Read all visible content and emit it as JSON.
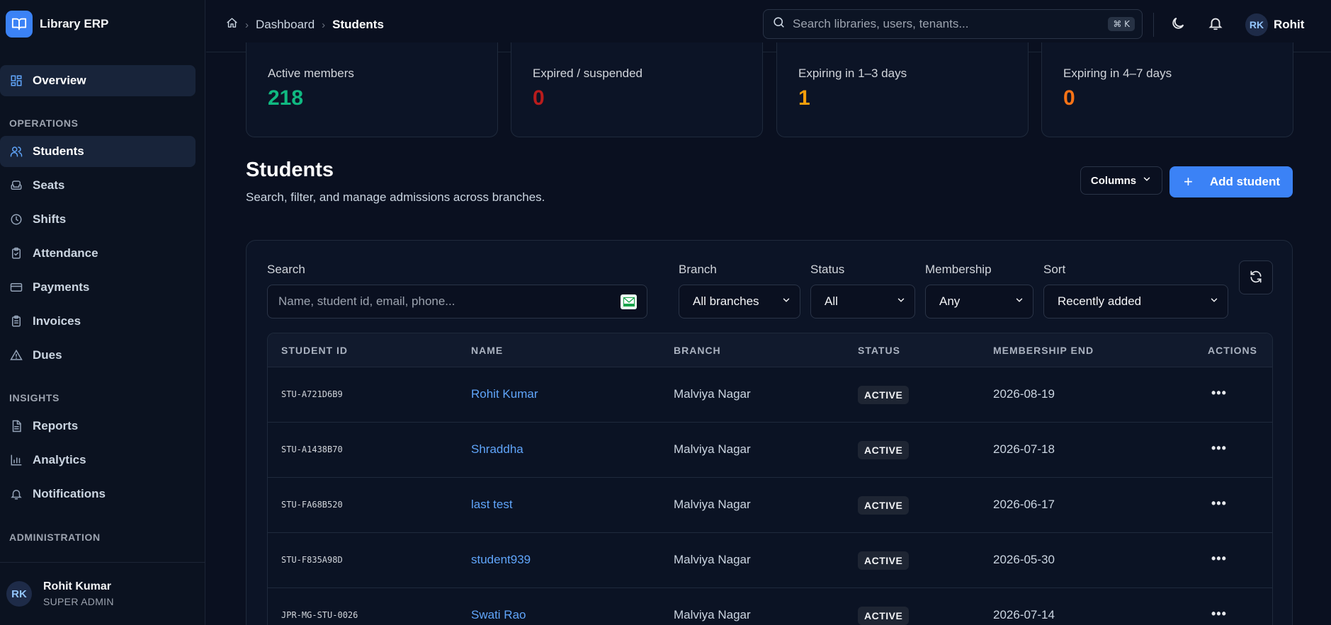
{
  "app": {
    "name": "Library ERP"
  },
  "sidebar": {
    "overview": "Overview",
    "sections": {
      "operations": "OPERATIONS",
      "insights": "INSIGHTS",
      "administration": "ADMINISTRATION"
    },
    "operations": [
      "Students",
      "Seats",
      "Shifts",
      "Attendance",
      "Payments",
      "Invoices",
      "Dues"
    ],
    "insights": [
      "Reports",
      "Analytics",
      "Notifications"
    ],
    "user": {
      "initials": "RK",
      "name": "Rohit Kumar",
      "role": "SUPER ADMIN"
    }
  },
  "topbar": {
    "breadcrumb": [
      "Dashboard",
      "Students"
    ],
    "search_placeholder": "Search libraries, users, tenants...",
    "shortcut": "⌘ K",
    "user": {
      "initials": "RK",
      "name": "Rohit"
    }
  },
  "stats": [
    {
      "label": "Active members",
      "value": "218",
      "color": "#10b981"
    },
    {
      "label": "Expired / suspended",
      "value": "0",
      "color": "#b91c1c"
    },
    {
      "label": "Expiring in 1–3 days",
      "value": "1",
      "color": "#f59e0b"
    },
    {
      "label": "Expiring in 4–7 days",
      "value": "0",
      "color": "#f97316"
    }
  ],
  "page": {
    "title": "Students",
    "subtitle": "Search, filter, and manage admissions across branches.",
    "columns_button": "Columns",
    "add_button": "Add student"
  },
  "filters": {
    "search_label": "Search",
    "search_placeholder": "Name, student id, email, phone...",
    "branch_label": "Branch",
    "branch_value": "All branches",
    "status_label": "Status",
    "status_value": "All",
    "membership_label": "Membership",
    "membership_value": "Any",
    "sort_label": "Sort",
    "sort_value": "Recently added"
  },
  "table": {
    "headers": [
      "STUDENT ID",
      "NAME",
      "BRANCH",
      "STATUS",
      "MEMBERSHIP END",
      "ACTIONS"
    ],
    "rows": [
      {
        "id": "STU-A721D6B9",
        "name": "Rohit Kumar",
        "branch": "Malviya Nagar",
        "status": "ACTIVE",
        "end": "2026-08-19"
      },
      {
        "id": "STU-A1438B70",
        "name": "Shraddha",
        "branch": "Malviya Nagar",
        "status": "ACTIVE",
        "end": "2026-07-18"
      },
      {
        "id": "STU-FA68B520",
        "name": "last test",
        "branch": "Malviya Nagar",
        "status": "ACTIVE",
        "end": "2026-06-17"
      },
      {
        "id": "STU-F835A98D",
        "name": "student939",
        "branch": "Malviya Nagar",
        "status": "ACTIVE",
        "end": "2026-05-30"
      },
      {
        "id": "JPR-MG-STU-0026",
        "name": "Swati Rao",
        "branch": "Malviya Nagar",
        "status": "ACTIVE",
        "end": "2026-07-14"
      }
    ]
  },
  "colors": {
    "accent": "#3b82f6",
    "link": "#60a5fa",
    "background": "#0a1020"
  }
}
